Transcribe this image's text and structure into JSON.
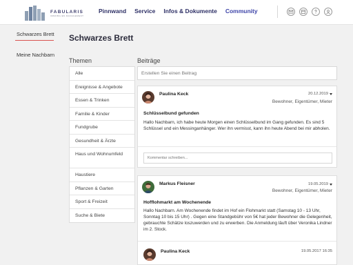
{
  "header": {
    "logo_name": "FABULARIS",
    "logo_tagline": "IMMOBILIEN MANAGEMENT",
    "nav": [
      {
        "label": "Pinnwand",
        "active": false
      },
      {
        "label": "Service",
        "active": false
      },
      {
        "label": "Infos & Dokumente",
        "active": false
      },
      {
        "label": "Community",
        "active": true
      }
    ],
    "icons": [
      "mail-icon",
      "calendar-icon",
      "help-icon",
      "user-icon"
    ]
  },
  "leftnav": {
    "items": [
      {
        "label": "Schwarzes Brett",
        "active": true
      },
      {
        "label": "Meine Nachbarn",
        "active": false
      }
    ]
  },
  "page_title": "Schwarzes Brett",
  "themes": {
    "heading": "Themen",
    "items": [
      "Alle",
      "Ereignisse & Angebote",
      "Essen & Trinken",
      "Familie & Kinder",
      "Fundgrube",
      "Gesundheit & Ärzte",
      "Haus und Wohnumfeld",
      "Haustiere",
      "Pflanzen & Garten",
      "Sport & Freizeit",
      "Suche & Biete"
    ]
  },
  "posts_section": {
    "heading": "Beiträge",
    "compose_placeholder": "Erstellen Sie einen Beitrag"
  },
  "posts": [
    {
      "author": "Paulina Keck",
      "date": "20.12.2019",
      "roles": "Bewohner, Eigentümer, Mieter",
      "title": "Schlüsselbund gefunden",
      "body": "Hallo Nachbarn, ich habe heute Morgen einen Schlüsselbund im Gang gefunden. Es sind 5 Schlüssel und ein Messinganhänger. Wer ihn vermisst, kann ihn heute Abend bei mir abholen.",
      "comment_placeholder": "Kommentar schreiben..."
    },
    {
      "author": "Markus Fleisner",
      "date": "19.05.2019",
      "roles": "Bewohner, Eigentümer, Mieter",
      "title": "Hofflohmarkt am Wochenende",
      "body": "Hallo Nachbarn. Am Wochenende findet im Hof ein Flohmarkt statt (Samstag 10 - 13 Uhr, Sonntag 10 bis 15 Uhr) . Gegen eine Standgebühr von 5€ hat jeder Bewohner die Gelegenheit, gebrauchte Schätze loszuwerden und zu erwerben. Die Anmeldung läuft über Veronika Lindner im 2. Stock."
    }
  ],
  "reply": {
    "author": "Paulina Keck",
    "date": "19.05.2017 16:35"
  },
  "colors": {
    "brand_navy": "#2e3066",
    "accent_red": "#d9534f",
    "background": "#f1f1f1"
  }
}
